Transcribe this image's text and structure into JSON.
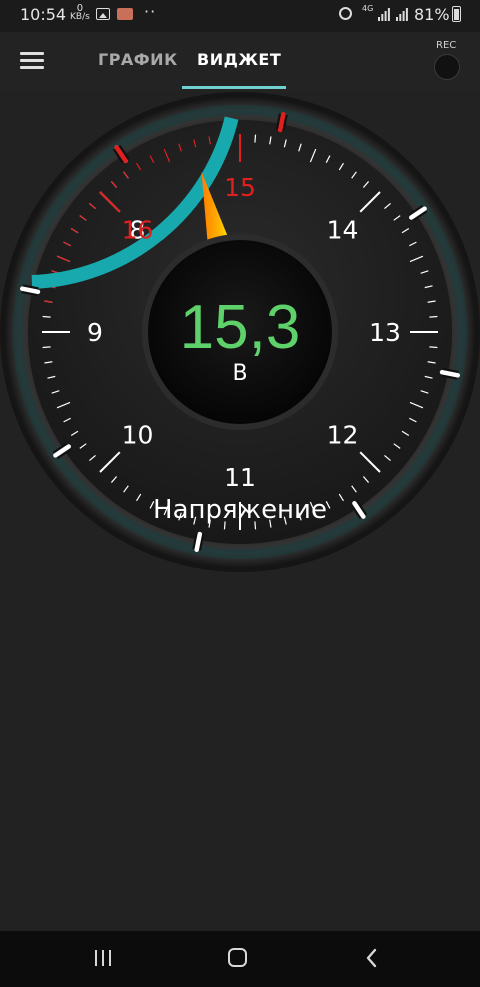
{
  "status_bar": {
    "time": "10:54",
    "net_speed_value": "0",
    "net_speed_unit": "KB/s",
    "dots": "··",
    "network_type": "4G",
    "battery": "81%"
  },
  "app_bar": {
    "tabs": [
      {
        "label": "ГРАФИК",
        "active": false
      },
      {
        "label": "ВИДЖЕТ",
        "active": true
      }
    ],
    "rec_label": "REC",
    "accent_color": "#6fd0cf"
  },
  "gauge": {
    "value": "15,3",
    "unit": "В",
    "label": "Напряжение",
    "value_color": "#5ed16b",
    "scale_labels": [
      {
        "text": "8",
        "value": 8
      },
      {
        "text": "9",
        "value": 9
      },
      {
        "text": "10",
        "value": 10
      },
      {
        "text": "11",
        "value": 11
      },
      {
        "text": "12",
        "value": 12
      },
      {
        "text": "13",
        "value": 13
      },
      {
        "text": "14",
        "value": 14
      },
      {
        "text": "15",
        "value": 15
      },
      {
        "text": "16",
        "value": 16
      }
    ],
    "red_zone_from": 15,
    "needle_value": 15.3,
    "colors": {
      "normal": "#ffffff",
      "warning": "#e01f1f",
      "arc": "#17a9ad",
      "needle": "#ff9a1a"
    }
  },
  "nav_bar": {
    "buttons": [
      "recents",
      "home",
      "back"
    ]
  }
}
